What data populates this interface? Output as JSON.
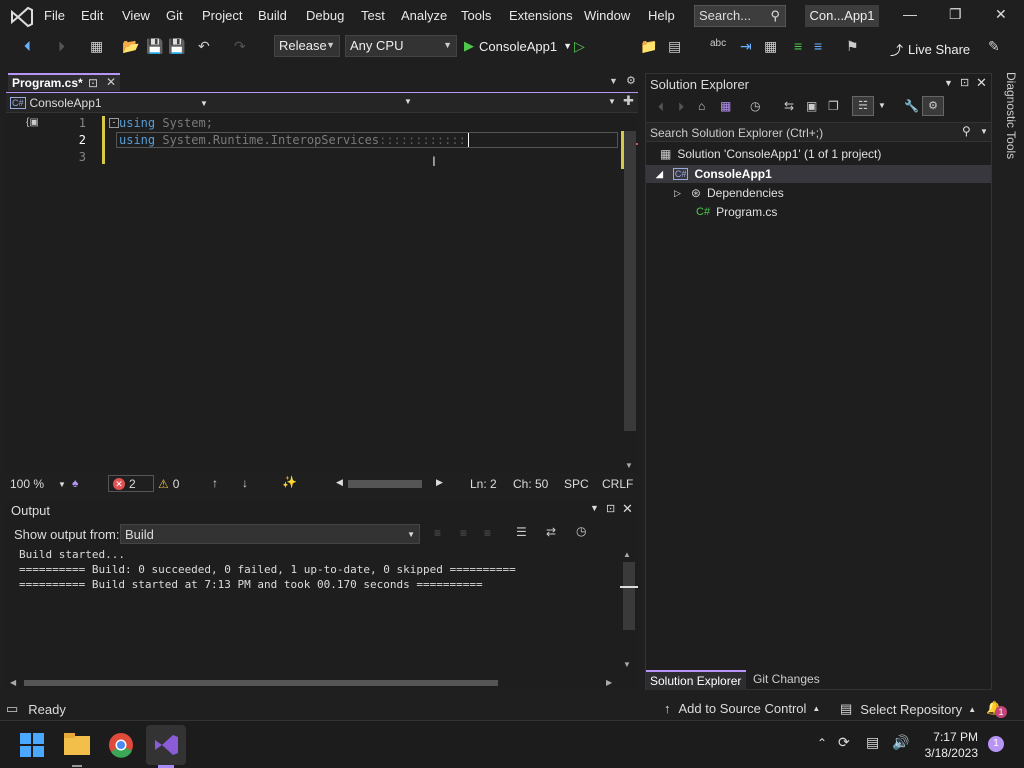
{
  "menubar": {
    "items": [
      "File",
      "Edit",
      "View",
      "Git",
      "Project",
      "Build",
      "Debug",
      "Test",
      "Analyze",
      "Tools",
      "Extensions",
      "Window",
      "Help"
    ],
    "search_placeholder": "Search...",
    "window_title": "Con...App1"
  },
  "toolbar": {
    "config": "Release",
    "platform": "Any CPU",
    "run_target": "ConsoleApp1",
    "live_share": "Live Share"
  },
  "editor": {
    "tab_label": "Program.cs*",
    "project_combo": "ConsoleApp1",
    "lines": [
      {
        "num": "1",
        "kw": "using",
        "rest": " System;"
      },
      {
        "num": "2",
        "kw": "using",
        "rest": " System.Runtime.InteropServices",
        "tail": "::::::::::::"
      },
      {
        "num": "3",
        "kw": "",
        "rest": ""
      }
    ]
  },
  "editor_status": {
    "zoom": "100 %",
    "errors": "2",
    "warnings": "0",
    "line": "Ln: 2",
    "char": "Ch: 50",
    "spc": "SPC",
    "crlf": "CRLF"
  },
  "output": {
    "title": "Output",
    "show_label": "Show output from:",
    "source": "Build",
    "lines": [
      "Build started...",
      "========== Build: 0 succeeded, 0 failed, 1 up-to-date, 0 skipped ==========",
      "========== Build started at 7:13 PM and took 00.170 seconds =========="
    ]
  },
  "solution_explorer": {
    "title": "Solution Explorer",
    "search_placeholder": "Search Solution Explorer (Ctrl+;)",
    "solution": "Solution 'ConsoleApp1' (1 of 1 project)",
    "project": "ConsoleApp1",
    "dependencies": "Dependencies",
    "file": "Program.cs",
    "bottom_tabs": [
      "Solution Explorer",
      "Git Changes"
    ]
  },
  "side_label": "Diagnostic Tools",
  "statusbar": {
    "ready": "Ready",
    "add_source": "Add to Source Control",
    "select_repo": "Select Repository",
    "notif_count": "1"
  },
  "taskbar": {
    "time": "7:17 PM",
    "date": "3/18/2023",
    "badge": "1"
  },
  "colors": {
    "accent": "#b794f6",
    "keyword": "#569cd6",
    "error": "#e05252"
  }
}
